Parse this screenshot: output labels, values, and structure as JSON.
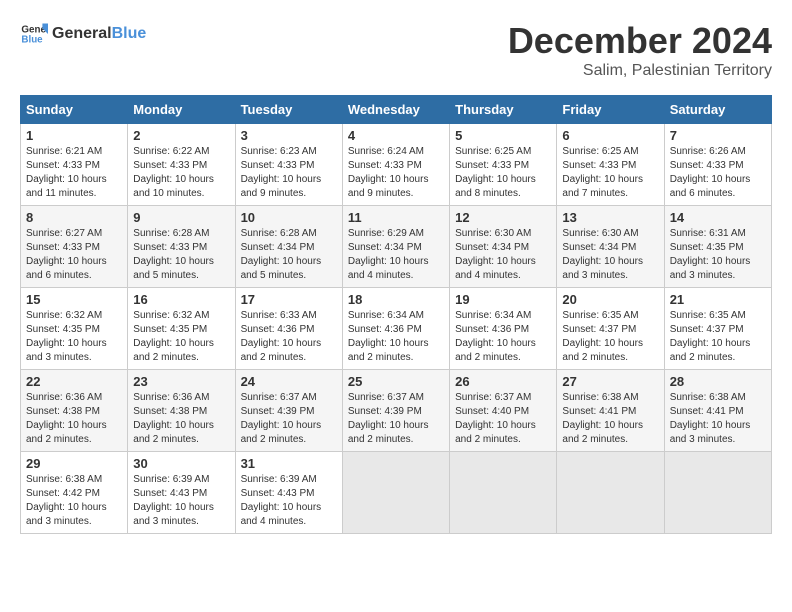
{
  "header": {
    "logo_general": "General",
    "logo_blue": "Blue",
    "month": "December 2024",
    "location": "Salim, Palestinian Territory"
  },
  "weekdays": [
    "Sunday",
    "Monday",
    "Tuesday",
    "Wednesday",
    "Thursday",
    "Friday",
    "Saturday"
  ],
  "weeks": [
    [
      {
        "day": 1,
        "sunrise": "6:21 AM",
        "sunset": "4:33 PM",
        "daylight": "10 hours and 11 minutes."
      },
      {
        "day": 2,
        "sunrise": "6:22 AM",
        "sunset": "4:33 PM",
        "daylight": "10 hours and 10 minutes."
      },
      {
        "day": 3,
        "sunrise": "6:23 AM",
        "sunset": "4:33 PM",
        "daylight": "10 hours and 9 minutes."
      },
      {
        "day": 4,
        "sunrise": "6:24 AM",
        "sunset": "4:33 PM",
        "daylight": "10 hours and 9 minutes."
      },
      {
        "day": 5,
        "sunrise": "6:25 AM",
        "sunset": "4:33 PM",
        "daylight": "10 hours and 8 minutes."
      },
      {
        "day": 6,
        "sunrise": "6:25 AM",
        "sunset": "4:33 PM",
        "daylight": "10 hours and 7 minutes."
      },
      {
        "day": 7,
        "sunrise": "6:26 AM",
        "sunset": "4:33 PM",
        "daylight": "10 hours and 6 minutes."
      }
    ],
    [
      {
        "day": 8,
        "sunrise": "6:27 AM",
        "sunset": "4:33 PM",
        "daylight": "10 hours and 6 minutes."
      },
      {
        "day": 9,
        "sunrise": "6:28 AM",
        "sunset": "4:33 PM",
        "daylight": "10 hours and 5 minutes."
      },
      {
        "day": 10,
        "sunrise": "6:28 AM",
        "sunset": "4:34 PM",
        "daylight": "10 hours and 5 minutes."
      },
      {
        "day": 11,
        "sunrise": "6:29 AM",
        "sunset": "4:34 PM",
        "daylight": "10 hours and 4 minutes."
      },
      {
        "day": 12,
        "sunrise": "6:30 AM",
        "sunset": "4:34 PM",
        "daylight": "10 hours and 4 minutes."
      },
      {
        "day": 13,
        "sunrise": "6:30 AM",
        "sunset": "4:34 PM",
        "daylight": "10 hours and 3 minutes."
      },
      {
        "day": 14,
        "sunrise": "6:31 AM",
        "sunset": "4:35 PM",
        "daylight": "10 hours and 3 minutes."
      }
    ],
    [
      {
        "day": 15,
        "sunrise": "6:32 AM",
        "sunset": "4:35 PM",
        "daylight": "10 hours and 3 minutes."
      },
      {
        "day": 16,
        "sunrise": "6:32 AM",
        "sunset": "4:35 PM",
        "daylight": "10 hours and 2 minutes."
      },
      {
        "day": 17,
        "sunrise": "6:33 AM",
        "sunset": "4:36 PM",
        "daylight": "10 hours and 2 minutes."
      },
      {
        "day": 18,
        "sunrise": "6:34 AM",
        "sunset": "4:36 PM",
        "daylight": "10 hours and 2 minutes."
      },
      {
        "day": 19,
        "sunrise": "6:34 AM",
        "sunset": "4:36 PM",
        "daylight": "10 hours and 2 minutes."
      },
      {
        "day": 20,
        "sunrise": "6:35 AM",
        "sunset": "4:37 PM",
        "daylight": "10 hours and 2 minutes."
      },
      {
        "day": 21,
        "sunrise": "6:35 AM",
        "sunset": "4:37 PM",
        "daylight": "10 hours and 2 minutes."
      }
    ],
    [
      {
        "day": 22,
        "sunrise": "6:36 AM",
        "sunset": "4:38 PM",
        "daylight": "10 hours and 2 minutes."
      },
      {
        "day": 23,
        "sunrise": "6:36 AM",
        "sunset": "4:38 PM",
        "daylight": "10 hours and 2 minutes."
      },
      {
        "day": 24,
        "sunrise": "6:37 AM",
        "sunset": "4:39 PM",
        "daylight": "10 hours and 2 minutes."
      },
      {
        "day": 25,
        "sunrise": "6:37 AM",
        "sunset": "4:39 PM",
        "daylight": "10 hours and 2 minutes."
      },
      {
        "day": 26,
        "sunrise": "6:37 AM",
        "sunset": "4:40 PM",
        "daylight": "10 hours and 2 minutes."
      },
      {
        "day": 27,
        "sunrise": "6:38 AM",
        "sunset": "4:41 PM",
        "daylight": "10 hours and 2 minutes."
      },
      {
        "day": 28,
        "sunrise": "6:38 AM",
        "sunset": "4:41 PM",
        "daylight": "10 hours and 3 minutes."
      }
    ],
    [
      {
        "day": 29,
        "sunrise": "6:38 AM",
        "sunset": "4:42 PM",
        "daylight": "10 hours and 3 minutes."
      },
      {
        "day": 30,
        "sunrise": "6:39 AM",
        "sunset": "4:43 PM",
        "daylight": "10 hours and 3 minutes."
      },
      {
        "day": 31,
        "sunrise": "6:39 AM",
        "sunset": "4:43 PM",
        "daylight": "10 hours and 4 minutes."
      },
      null,
      null,
      null,
      null
    ]
  ]
}
